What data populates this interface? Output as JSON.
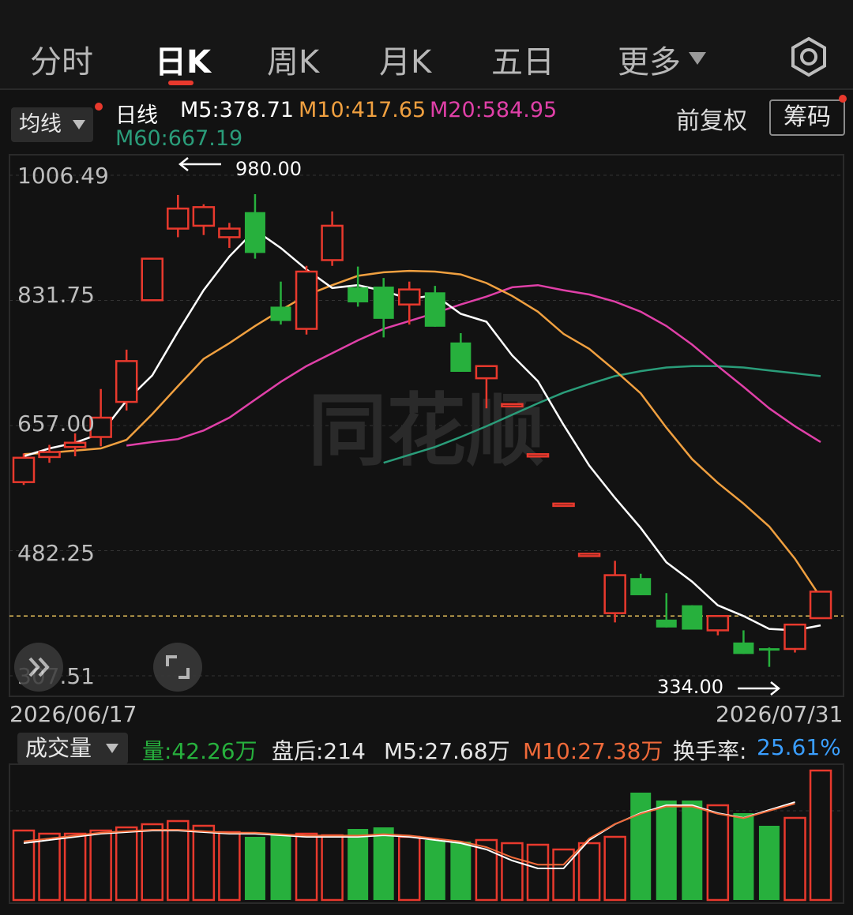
{
  "tabs": [
    {
      "label": "分时",
      "active": false
    },
    {
      "label": "日K",
      "active": true
    },
    {
      "label": "周K",
      "active": false
    },
    {
      "label": "月K",
      "active": false
    },
    {
      "label": "五日",
      "active": false
    },
    {
      "label": "更多",
      "active": false
    }
  ],
  "icons": {
    "more_dropdown": "triangle-down-icon",
    "settings": "gear-icon",
    "expand": "double-chevron-icon",
    "fullscreen": "corners-icon"
  },
  "header": {
    "ma_button": "均线",
    "ma5": "M5:378.71",
    "ma10": "M10:417.65",
    "ma20": "M20:584.95",
    "ma60": "M60:667.19",
    "price_adjust": "前复权",
    "chip_button": "筹码"
  },
  "colors": {
    "up": "#e8392d",
    "down": "#27b03d",
    "ma5": "#ffffff",
    "ma10": "#f0a040",
    "ma20": "#e040a8",
    "ma60": "#2a9d7a",
    "turnover": "#3a9eff"
  },
  "volume_header": {
    "button": "成交量",
    "volume": "量:42.26万",
    "after_hours": "盘后:214",
    "m5": "M5:27.68万",
    "m10": "M10:27.38万",
    "turnover_label": "换手率:",
    "turnover_value": "25.61%"
  },
  "watermark": "同花顺",
  "chart_data": {
    "type": "candlestick",
    "y_ticks": [
      "1006.49",
      "831.75",
      "657.00",
      "482.25",
      "307.51"
    ],
    "ylim": [
      307.51,
      1006.49
    ],
    "x_start": "2026/06/17",
    "x_end": "2026/07/31",
    "annotations": {
      "high": "980.00",
      "low": "334.00"
    },
    "reference_price": 391,
    "candles": [
      {
        "o": 578,
        "c": 612,
        "h": 618,
        "l": 574
      },
      {
        "o": 613,
        "c": 620,
        "h": 630,
        "l": 605
      },
      {
        "o": 627,
        "c": 633,
        "h": 646,
        "l": 614
      },
      {
        "o": 641,
        "c": 668,
        "h": 708,
        "l": 628
      },
      {
        "o": 690,
        "c": 747,
        "h": 763,
        "l": 678
      },
      {
        "o": 832,
        "c": 890,
        "h": 890,
        "l": 832
      },
      {
        "o": 932,
        "c": 960,
        "h": 979,
        "l": 920
      },
      {
        "o": 936,
        "c": 962,
        "h": 966,
        "l": 923
      },
      {
        "o": 920,
        "c": 932,
        "h": 940,
        "l": 905
      },
      {
        "o": 955,
        "c": 898,
        "h": 980,
        "l": 890
      },
      {
        "o": 823,
        "c": 803,
        "h": 858,
        "l": 798
      },
      {
        "o": 792,
        "c": 872,
        "h": 880,
        "l": 784
      },
      {
        "o": 888,
        "c": 936,
        "h": 956,
        "l": 880
      },
      {
        "o": 850,
        "c": 829,
        "h": 879,
        "l": 823
      },
      {
        "o": 851,
        "c": 806,
        "h": 863,
        "l": 780
      },
      {
        "o": 826,
        "c": 847,
        "h": 858,
        "l": 798
      },
      {
        "o": 843,
        "c": 795,
        "h": 852,
        "l": 795
      },
      {
        "o": 773,
        "c": 732,
        "h": 786,
        "l": 732
      },
      {
        "o": 723,
        "c": 740,
        "h": 740,
        "l": 681
      },
      {
        "o": 687,
        "c": 687,
        "h": 687,
        "l": 687
      },
      {
        "o": 617,
        "c": 617,
        "h": 617,
        "l": 617
      },
      {
        "o": 548,
        "c": 548,
        "h": 548,
        "l": 548
      },
      {
        "o": 478,
        "c": 478,
        "h": 478,
        "l": 478
      },
      {
        "o": 395,
        "c": 448,
        "h": 468,
        "l": 382
      },
      {
        "o": 444,
        "c": 420,
        "h": 450,
        "l": 420
      },
      {
        "o": 386,
        "c": 375,
        "h": 423,
        "l": 375
      },
      {
        "o": 406,
        "c": 372,
        "h": 406,
        "l": 372
      },
      {
        "o": 371,
        "c": 391,
        "h": 391,
        "l": 364
      },
      {
        "o": 354,
        "c": 338,
        "h": 371,
        "l": 338
      },
      {
        "o": 346,
        "c": 344,
        "h": 347,
        "l": 320
      },
      {
        "o": 345,
        "c": 379,
        "h": 379,
        "l": 340
      },
      {
        "o": 388,
        "c": 425,
        "h": 425,
        "l": 388
      }
    ],
    "ma5": [
      614,
      625,
      633,
      646,
      692,
      727,
      788,
      846,
      893,
      930,
      905,
      875,
      849,
      853,
      845,
      834,
      839,
      813,
      802,
      755,
      719,
      658,
      601,
      556,
      514,
      466,
      439,
      406,
      391,
      373,
      371,
      378
    ],
    "ma10": [
      617,
      619,
      622,
      625,
      637,
      673,
      712,
      750,
      772,
      796,
      818,
      839,
      853,
      866,
      871,
      873,
      872,
      868,
      856,
      838,
      816,
      785,
      764,
      734,
      702,
      654,
      610,
      577,
      548,
      516,
      471,
      417
    ],
    "ma20": [
      629,
      634,
      638,
      650,
      668,
      693,
      718,
      740,
      758,
      776,
      792,
      803,
      814,
      826,
      837,
      850,
      853,
      846,
      840,
      830,
      816,
      796,
      770,
      740,
      711,
      681,
      656,
      634
    ],
    "ma60": [
      605,
      616,
      627,
      641,
      656,
      672,
      688,
      703,
      715,
      726,
      733,
      738,
      740,
      740,
      738,
      734,
      730,
      726
    ],
    "volumes": [
      44,
      42,
      42,
      44,
      46,
      48,
      50,
      47,
      43,
      40,
      41,
      42,
      41,
      45,
      46,
      40,
      38,
      37,
      38,
      36,
      35,
      32,
      36,
      40,
      68,
      63,
      63,
      60,
      55,
      47,
      52,
      82
    ],
    "vol_ma": [
      36,
      38,
      40,
      42,
      43,
      44,
      44,
      43,
      42,
      42,
      41,
      40,
      40,
      40,
      41,
      40,
      38,
      36,
      32,
      25,
      20,
      20,
      38,
      48,
      55,
      60,
      60,
      55,
      52,
      57,
      62
    ]
  }
}
